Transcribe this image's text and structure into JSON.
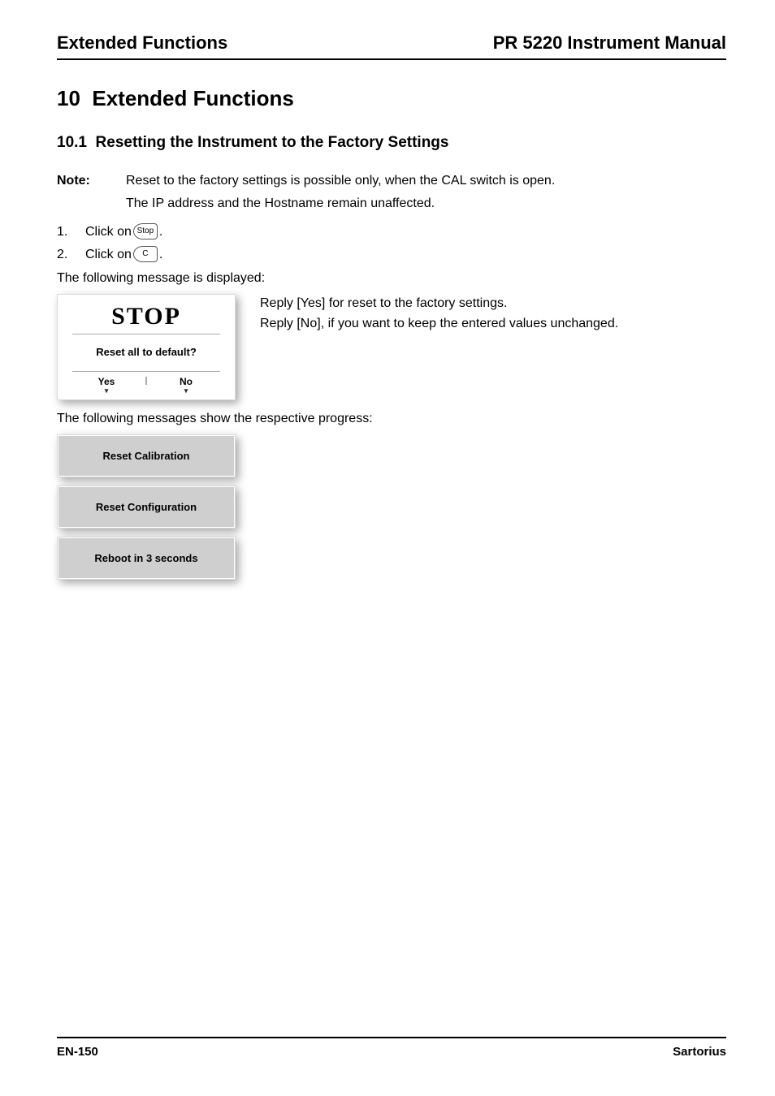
{
  "header": {
    "left": "Extended Functions",
    "right": "PR 5220 Instrument Manual"
  },
  "section": {
    "number": "10",
    "title": "Extended Functions"
  },
  "subsection": {
    "number": "10.1",
    "title": "Resetting the Instrument to the Factory Settings"
  },
  "note": {
    "label": "Note:",
    "line1": "Reset to the factory settings is possible only, when the CAL switch is open.",
    "line2": "The IP address and the Hostname remain unaffected."
  },
  "steps": [
    {
      "num": "1.",
      "prefix": "Click on ",
      "key_label": "Stop",
      "suffix": "."
    },
    {
      "num": "2.",
      "prefix": "Click on ",
      "key_label": "C",
      "suffix": "."
    }
  ],
  "message_intro": "The following message is displayed:",
  "stop_panel": {
    "title": "STOP",
    "question": "Reset all to default?",
    "yes": "Yes",
    "no": "No"
  },
  "reply_lines": {
    "yes": "Reply [Yes] for reset to the factory settings.",
    "no": "Reply [No], if you want to keep the entered values unchanged."
  },
  "progress_intro": "The following messages show the respective progress:",
  "progress": [
    "Reset Calibration",
    "Reset Configuration",
    "Reboot in 3 seconds"
  ],
  "footer": {
    "left": "EN-150",
    "right": "Sartorius"
  }
}
